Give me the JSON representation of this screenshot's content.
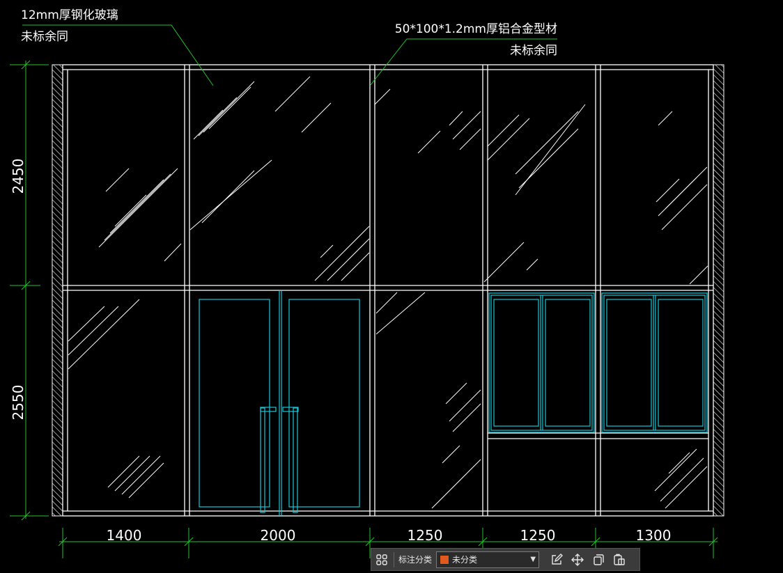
{
  "annotations": {
    "glass_line1": "12mm厚钢化玻璃",
    "glass_line2": "未标余同",
    "frame_line1": "50*100*1.2mm厚铝合金型材",
    "frame_line2": "未标余同"
  },
  "dimensions": {
    "vertical": [
      "2450",
      "2550"
    ],
    "horizontal": [
      "1400",
      "2000",
      "1250",
      "1250",
      "1300"
    ]
  },
  "toolbar": {
    "grid_icon": "grid-icon",
    "label": "标注分类",
    "select_value": "未分类",
    "select_color": "#e05a1e",
    "tools": [
      "edit-icon",
      "move-icon",
      "copy-icon",
      "paste-icon"
    ]
  },
  "colors": {
    "background": "#000000",
    "lines": "#ffffff",
    "leader": "#22c32b",
    "door": "#18c8d8"
  }
}
